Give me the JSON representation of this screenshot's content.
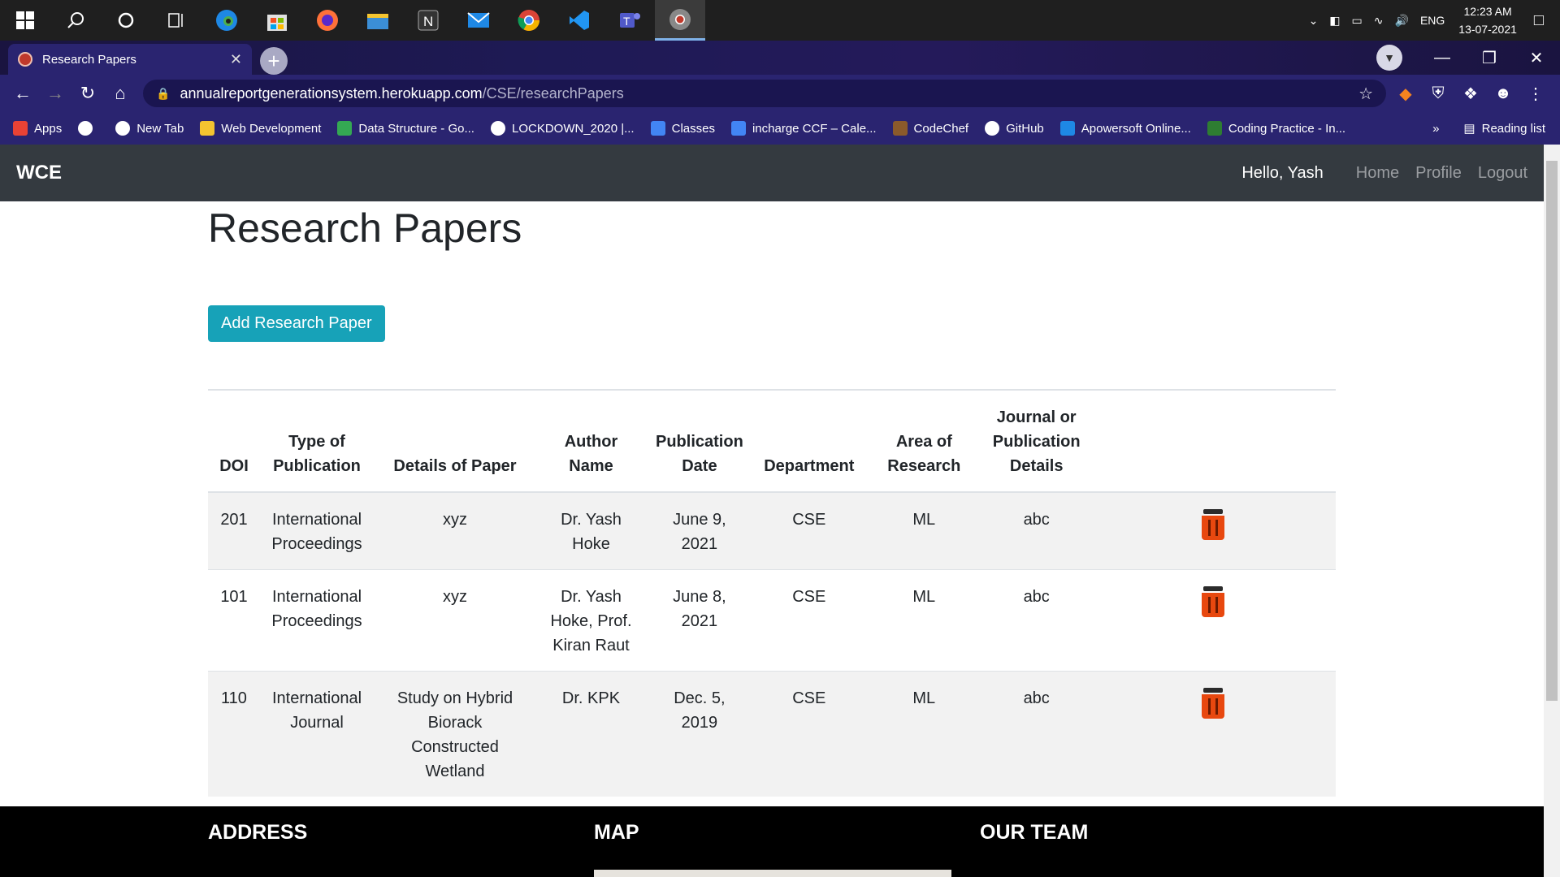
{
  "taskbar": {
    "icons": [
      "windows-icon",
      "search-icon",
      "cortana-icon",
      "task-view-icon",
      "edge-icon",
      "store-icon",
      "firefox-icon",
      "file-explorer-icon",
      "notion-icon",
      "mail-icon",
      "chrome-icon",
      "vscode-icon",
      "teams-icon",
      "chrome-dev-icon"
    ],
    "tray": {
      "lang": "ENG",
      "time": "12:23 AM",
      "date": "13-07-2021"
    }
  },
  "browser": {
    "tab_title": "Research Papers",
    "url_host": "annualreportgenerationsystem.herokuapp.com",
    "url_path": "/CSE/researchPapers",
    "bookmarks": [
      {
        "label": "Apps",
        "color": "#e94235"
      },
      {
        "label": "",
        "color": "#ffffff"
      },
      {
        "label": "New Tab",
        "color": "#ffffff"
      },
      {
        "label": "Web Development",
        "color": "#f4c430"
      },
      {
        "label": "Data Structure - Go...",
        "color": "#34a853"
      },
      {
        "label": "LOCKDOWN_2020 |...",
        "color": "#ffffff"
      },
      {
        "label": "Classes",
        "color": "#4285f4"
      },
      {
        "label": "incharge CCF – Cale...",
        "color": "#4285f4"
      },
      {
        "label": "CodeChef",
        "color": "#8b5a2b"
      },
      {
        "label": "GitHub",
        "color": "#ffffff"
      },
      {
        "label": "Apowersoft Online...",
        "color": "#1e88e5"
      },
      {
        "label": "Coding Practice - In...",
        "color": "#2e7d32"
      }
    ],
    "more_label": "»",
    "reading_list": "Reading list"
  },
  "navbar": {
    "brand": "WCE",
    "greeting": "Hello, Yash",
    "links": [
      "Home",
      "Profile",
      "Logout"
    ]
  },
  "page": {
    "title": "Research Papers",
    "add_button": "Add Research Paper"
  },
  "table": {
    "headers": [
      "DOI",
      "Type of Publication",
      "Details of Paper",
      "Author Name",
      "Publication Date",
      "Department",
      "Area of Research",
      "Journal or Publication Details"
    ],
    "rows": [
      {
        "doi": "201",
        "type": "International Proceedings",
        "details": "xyz",
        "author": "Dr. Yash Hoke",
        "date": "June 9, 2021",
        "dept": "CSE",
        "area": "ML",
        "journal": "abc"
      },
      {
        "doi": "101",
        "type": "International Proceedings",
        "details": "xyz",
        "author": "Dr. Yash Hoke, Prof. Kiran Raut",
        "date": "June 8, 2021",
        "dept": "CSE",
        "area": "ML",
        "journal": "abc"
      },
      {
        "doi": "110",
        "type": "International Journal",
        "details": "Study on Hybrid Biorack Constructed Wetland",
        "author": "Dr. KPK",
        "date": "Dec. 5, 2019",
        "dept": "CSE",
        "area": "ML",
        "journal": "abc"
      }
    ]
  },
  "footer": {
    "address": "ADDRESS",
    "map": "MAP",
    "team": "OUR TEAM"
  }
}
